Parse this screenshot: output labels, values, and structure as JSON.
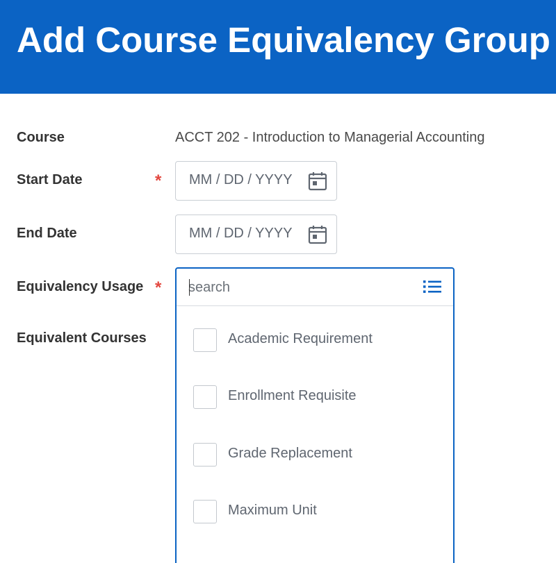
{
  "header": {
    "title": "Add Course Equivalency Group"
  },
  "form": {
    "course": {
      "label": "Course",
      "value": "ACCT 202 - Introduction to Managerial Accounting"
    },
    "start_date": {
      "label": "Start Date",
      "required": "*",
      "placeholder": "MM / DD / YYYY"
    },
    "end_date": {
      "label": "End Date",
      "placeholder": "MM / DD / YYYY"
    },
    "equivalency_usage": {
      "label": "Equivalency Usage",
      "required": "*",
      "search_placeholder": "search",
      "options": [
        {
          "label": "Academic Requirement",
          "checked": false
        },
        {
          "label": "Enrollment Requisite",
          "checked": false
        },
        {
          "label": "Grade Replacement",
          "checked": false
        },
        {
          "label": "Maximum Unit",
          "checked": false
        }
      ]
    },
    "equivalent_courses": {
      "label": "Equivalent Courses"
    }
  },
  "icons": {
    "calendar": "calendar-icon",
    "list": "list-icon"
  },
  "colors": {
    "header_bg": "#0b63c4",
    "accent": "#0b63c4",
    "required": "#e3473f"
  }
}
